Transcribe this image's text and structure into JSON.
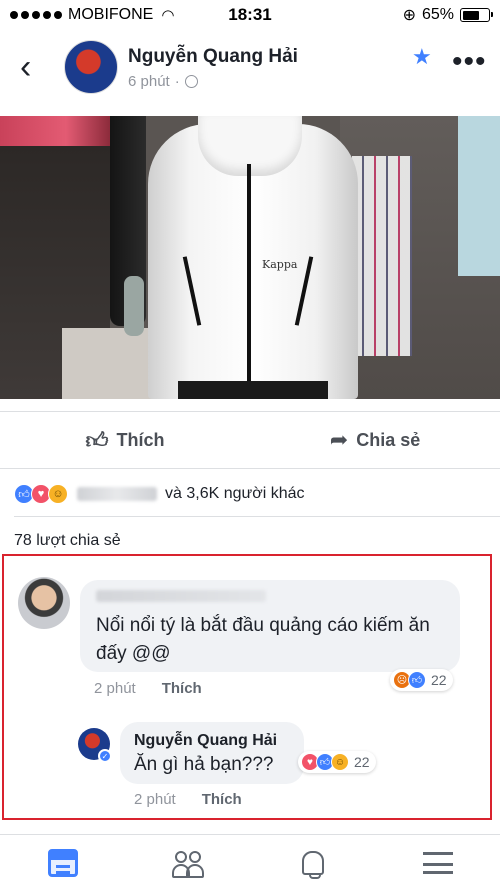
{
  "status_bar": {
    "carrier": "MOBIFONE",
    "time": "18:31",
    "battery": "65%",
    "battery_level": 0.65
  },
  "post": {
    "author": "Nguyễn Quang Hải",
    "time": "6 phút",
    "photo_logo": "Kappa"
  },
  "actions": {
    "like": "Thích",
    "share": "Chia sẻ"
  },
  "reactions": {
    "types": [
      "like",
      "love",
      "haha"
    ],
    "others": "và 3,6K người khác"
  },
  "shares": "78 lượt chia sẻ",
  "comments": [
    {
      "text": "Nổi nổi tý là bắt đầu quảng cáo kiếm ăn đấy @@",
      "time": "2 phút",
      "like_label": "Thích",
      "reactions": [
        "angry",
        "like"
      ],
      "reaction_count": "22"
    }
  ],
  "reply": {
    "author": "Nguyễn Quang Hải",
    "text": "Ăn gì hả bạn???",
    "time": "2 phút",
    "like_label": "Thích",
    "reactions": [
      "love",
      "like",
      "haha"
    ],
    "reaction_count": "22"
  },
  "colors": {
    "accent": "#4080ff",
    "highlight_border": "#d9232e",
    "bubble": "#f0f2f5"
  },
  "icons": {
    "nav": [
      "news-feed-icon",
      "friends-icon",
      "notifications-icon",
      "menu-icon"
    ]
  }
}
